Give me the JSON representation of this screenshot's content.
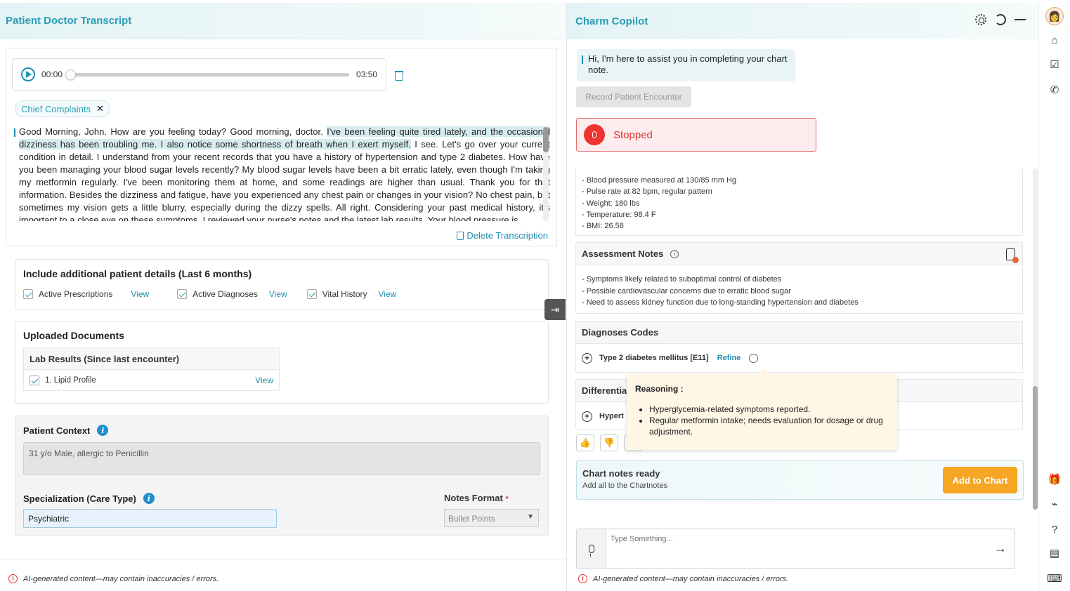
{
  "left": {
    "title": "Patient Doctor Transcript",
    "player": {
      "current_time": "00:00",
      "total_time": "03:50",
      "progress": 0
    },
    "chip_label": "Chief Complaints",
    "chip_close": "✕",
    "transcript": {
      "before": "Good Morning, John. How are you feeling today? Good morning, doctor. ",
      "highlight": "I've been feeling quite tired lately, and the occasional dizziness has been troubling me. I also notice some shortness of breath when I exert myself.",
      "after": " I see. Let's go over your current condition in detail. I understand from your recent records that you have a history of hypertension and type 2 diabetes. How have you been managing your blood sugar levels recently? My blood sugar levels have been a bit erratic lately, even though I'm taking my metformin regularly. I've been monitoring them at home, and some readings are higher than usual. Thank you for that information. Besides the dizziness and fatigue, have you experienced any chest pain or changes in your vision? No chest pain, but sometimes my vision gets a little blurry, especially during the dizzy spells. All right. Considering your past medical history, it's important to a close eye on these symptoms. I reviewed your nurse's notes and the latest lab results. Your blood pressure is"
    },
    "delete_transcription": "Delete Transcription",
    "additional": {
      "title": "Include additional patient details (Last 6 months)",
      "items": [
        {
          "label": "Active Prescriptions",
          "link": "View"
        },
        {
          "label": "Active Diagnoses",
          "link": "View"
        },
        {
          "label": "Vital History",
          "link": "View"
        }
      ]
    },
    "uploaded": {
      "title": "Uploaded Documents",
      "group_title": "Lab Results (Since last encounter)",
      "doc_label": "1. Lipid Profile",
      "doc_link": "View"
    },
    "context": {
      "title": "Patient Context",
      "info": "i",
      "value": "31 y/o Male, allergic to Penicillin",
      "specialization_label": "Specialization (Care Type)",
      "specialization_value": "Psychiatric",
      "notes_format_label": "Notes Format",
      "required_mark": "*",
      "notes_format_value": "Bullet Points"
    },
    "ai_note": "AI-generated content—may contain inaccuracies / errors."
  },
  "right": {
    "title": "Charm Copilot",
    "greeting": "Hi, I'm here to assist you in completing your chart note.",
    "record_button": "Record Patient Encounter",
    "status": "Stopped",
    "vitals": [
      "- Blood pressure measured at 130/85 mm Hg",
      "- Pulse rate at 82 bpm, regular pattern",
      "- Weight: 180 lbs",
      "- Temperature: 98.4 F",
      "- BMI: 26.58"
    ],
    "assessment": {
      "title": "Assessment Notes",
      "info": "i",
      "lines": [
        "- Symptoms likely related to suboptimal control of diabetes",
        "- Possible cardiovascular concerns due to erratic blood sugar",
        "- Need to assess kidney function due to long-standing hypertension and diabetes"
      ]
    },
    "diagnoses": {
      "title": "Diagnoses Codes",
      "code": "Type 2 diabetes mellitus [E11]",
      "refine": "Refine"
    },
    "differential": {
      "title_partial": "Differentia",
      "code_partial": "Hypert"
    },
    "tooltip": {
      "title": "Reasoning :",
      "points": [
        "Hyperglycemia-related symptoms reported.",
        "Regular metformin intake; needs evaluation for dosage or drug adjustment."
      ]
    },
    "chart_ready": {
      "title": "Chart notes ready",
      "subtitle": "Add all to the Chartnotes",
      "button": "Add to Chart"
    },
    "input_placeholder": "Type Something...",
    "ai_note": "AI-generated content—may contain inaccuracies / errors."
  },
  "colors": {
    "accent": "#2a9db5",
    "stop_red": "#e33333",
    "add_button": "#f5a623",
    "tooltip_bg": "#fff6e6"
  }
}
